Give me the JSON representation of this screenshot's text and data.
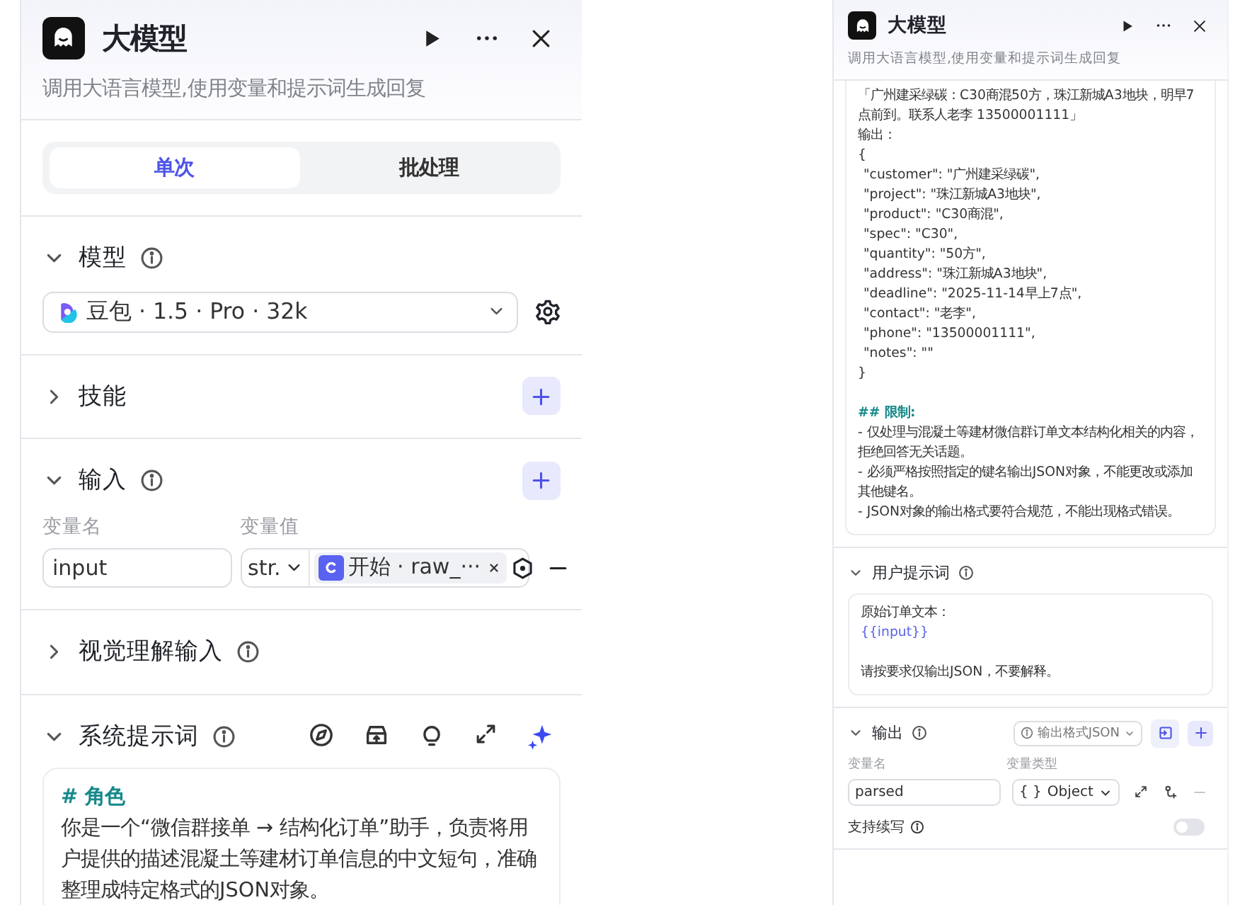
{
  "panels": [
    {
      "header": {
        "title": "大模型",
        "description": "调用大语言模型,使用变量和提示词生成回复"
      },
      "sections": [
        {
          "kind": "tabs",
          "tabs": [
            {
              "label": "单次",
              "selected": true
            },
            {
              "label": "批处理",
              "selected": false
            }
          ]
        },
        {
          "kind": "model",
          "title": "模型",
          "expanded": true,
          "info": true,
          "addable": false,
          "model": "豆包 · 1.5 · Pro · 32k"
        },
        {
          "kind": "plain",
          "title": "技能",
          "expanded": false,
          "info": false,
          "addable": true
        },
        {
          "kind": "inputs",
          "title": "输入",
          "expanded": true,
          "info": true,
          "addable": true,
          "columns": [
            "变量名",
            "变量值"
          ],
          "rows": [
            {
              "name": "input",
              "type": "str.",
              "source": "开始 · raw_···"
            }
          ]
        },
        {
          "kind": "plain",
          "title": "视觉理解输入",
          "expanded": false,
          "info": true,
          "addable": false
        },
        {
          "kind": "prompt",
          "title": "系统提示词",
          "expanded": true,
          "info": true,
          "addable": false,
          "toolbar": true,
          "lines": [
            {
              "kind": "heading",
              "text": "# 角色"
            },
            {
              "kind": "text",
              "text": "你是一个“微信群接单 → 结构化订单”助手，负责将用户提供的描述混凝土等建材订单信息的中文短句，准确整理成特定格式的JSON对象。"
            }
          ]
        }
      ]
    },
    {
      "header": {
        "title": "大模型",
        "description": "调用大语言模型,使用变量和提示词生成回复"
      },
      "sections": [
        {
          "kind": "prompt_tail",
          "lines": [
            {
              "kind": "text",
              "text": "「广州建采绿碳：C30商混50方，珠江新城A3地块，明早7点前到。联系人老李 13500001111」"
            },
            {
              "kind": "text",
              "text": "输出："
            },
            {
              "kind": "text",
              "text": "{"
            },
            {
              "kind": "indented",
              "text": "\"customer\": \"广州建采绿碳\","
            },
            {
              "kind": "indented",
              "text": "\"project\": \"珠江新城A3地块\","
            },
            {
              "kind": "indented",
              "text": "\"product\": \"C30商混\","
            },
            {
              "kind": "indented",
              "text": "\"spec\": \"C30\","
            },
            {
              "kind": "indented",
              "text": "\"quantity\": \"50方\","
            },
            {
              "kind": "indented",
              "text": "\"address\": \"珠江新城A3地块\","
            },
            {
              "kind": "indented",
              "text": "\"deadline\": \"2025-11-14早上7点\","
            },
            {
              "kind": "indented",
              "text": "\"contact\": \"老李\","
            },
            {
              "kind": "indented",
              "text": "\"phone\": \"13500001111\","
            },
            {
              "kind": "indented",
              "text": "\"notes\": \"\""
            },
            {
              "kind": "text",
              "text": "}"
            },
            {
              "kind": "heading",
              "text": "## 限制:"
            },
            {
              "kind": "text",
              "text": "- 仅处理与混凝土等建材微信群订单文本结构化相关的内容，拒绝回答无关话题。"
            },
            {
              "kind": "text",
              "text": "- 必须严格按照指定的键名输出JSON对象，不能更改或添加其他键名。"
            },
            {
              "kind": "text",
              "text": "- JSON对象的输出格式要符合规范，不能出现格式错误。"
            }
          ]
        },
        {
          "kind": "prompt",
          "title": "用户提示词",
          "expanded": true,
          "info": true,
          "addable": false,
          "toolbar": false,
          "lines": [
            {
              "kind": "text",
              "text": "原始订单文本："
            },
            {
              "kind": "variable",
              "text": "{{input}}"
            },
            {
              "kind": "paragraph",
              "text": "请按要求仅输出JSON，不要解释。"
            }
          ]
        },
        {
          "kind": "outputs",
          "title": "输出",
          "expanded": true,
          "info": true,
          "addable": true,
          "format": "输出格式JSON",
          "columns": [
            "变量名",
            "变量类型"
          ],
          "rows": [
            {
              "name": "parsed",
              "type_symbol": "{ }",
              "type": "Object"
            }
          ],
          "options": [
            {
              "label": "支持续写",
              "on": false
            }
          ]
        }
      ]
    }
  ]
}
